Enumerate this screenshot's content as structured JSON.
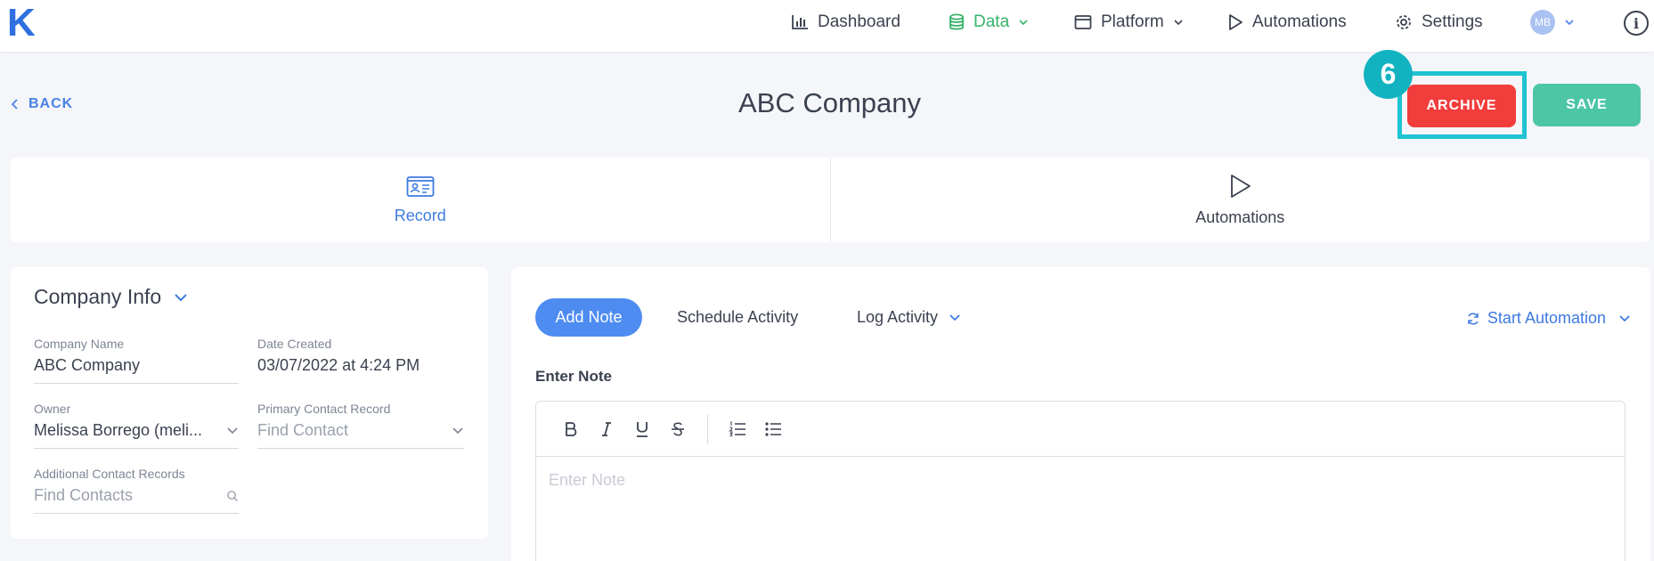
{
  "logo": "K",
  "nav": {
    "dashboard": "Dashboard",
    "data": "Data",
    "platform": "Platform",
    "automations": "Automations",
    "settings": "Settings",
    "avatar_initials": "MB",
    "info_glyph": "i"
  },
  "header": {
    "back_label": "BACK",
    "title": "ABC Company",
    "archive_label": "ARCHIVE",
    "save_label": "SAVE",
    "step_number": "6"
  },
  "tabs": [
    {
      "label": "Record",
      "icon": "contact-card-icon",
      "active": true
    },
    {
      "label": "Automations",
      "icon": "play-icon",
      "active": false
    }
  ],
  "company_info": {
    "title": "Company Info",
    "fields": {
      "company_name": {
        "label": "Company Name",
        "value": "ABC Company"
      },
      "date_created": {
        "label": "Date Created",
        "value": "03/07/2022 at 4:24 PM"
      },
      "owner": {
        "label": "Owner",
        "value": "Melissa Borrego (meli..."
      },
      "primary_contact": {
        "label": "Primary Contact Record",
        "placeholder": "Find Contact"
      },
      "additional_contacts": {
        "label": "Additional Contact Records",
        "placeholder": "Find Contacts"
      }
    }
  },
  "notes": {
    "add_note": "Add Note",
    "schedule_activity": "Schedule Activity",
    "log_activity": "Log Activity",
    "start_automation": "Start Automation",
    "enter_note_label": "Enter Note",
    "editor_placeholder": "Enter Note",
    "toolbar": [
      "bold",
      "italic",
      "underline",
      "strikethrough",
      "ordered-list",
      "bullet-list"
    ]
  },
  "colors": {
    "brand_blue": "#2f6fe0",
    "data_green": "#35b369",
    "archive_red": "#f23d3d",
    "save_teal": "#4dc6a6",
    "highlight_cyan": "#1fc3d2"
  }
}
